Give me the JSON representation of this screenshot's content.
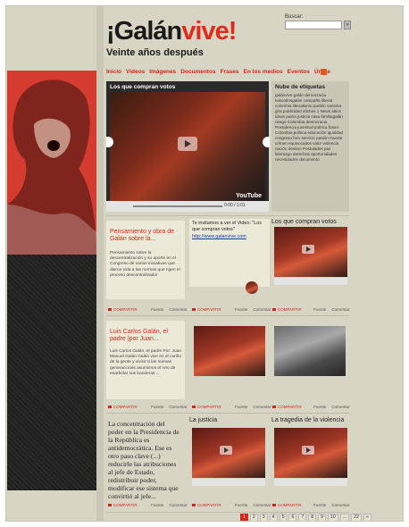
{
  "header": {
    "logo_main": "¡Galán",
    "logo_accent": "vive!",
    "tagline": "Veinte años después"
  },
  "search": {
    "label": "Buscar:",
    "value": "",
    "button": "»"
  },
  "nav": [
    "Inicio",
    "Videos",
    "Imágenes",
    "Documentos",
    "Frases",
    "En los medios",
    "Eventos",
    "Únete"
  ],
  "video": {
    "title": "Los que compran votos",
    "time": "0:00 / 1:01",
    "brand": "YouTube"
  },
  "tags": {
    "title": "Nube de etiquetas",
    "text": "galánvive galán democracia luiscarlosgalán campaña liberal colombia liberalismo pueblo carisma gira publicidad afiches 1 News altice ideas patria justicia casa familiagalán riesgo Colombia democracia Presidencia juventud política futuro Colombia política educación igualdad congreso foro servicio pasión muerte crimen equivocados valor violencia nación destino Postulados paz liderazgo derechos oportunidades necesidades documento"
  },
  "cards": {
    "c1_title": "Pensamiento y obra de Galán sobre la...",
    "c1_body": "Pensamiento sobre la descentralización y su aporte en el Congreso de varias iniciativas que dieron vida a las normas que rigen el proceso descentralizador",
    "c2_title": "Te invitamos a ver el Video: \"Los que compran votos\"",
    "c2_link": "http://www.galanvive.com",
    "c3_title": "Los que compran votos",
    "c4_title": "Luis Carlos Galán, el padre |por Juan...",
    "c4_body": "Luis Carlos Galán, el padre Por: Juan Manuel Galán Galán vive en el cariño de la gente y vivirá si las nuevas generaciones asumimos el reto de enarbolar sus banderas....",
    "c7_quote": "La concentración del poder en la Presidencia de la República es antidemocrática. Ese es otro paso clave (...) reducirle las atribuciones al jefe de Estado, redistribuir poder, modificar ese sistema que convirtió al jefe...",
    "c8_title": "La justicia",
    "c9_title": "La tragedia de la violencia",
    "share": "COMPARTIR",
    "meta_source": "Fuente",
    "meta_comment": "Comentar"
  },
  "pager": [
    "1",
    "2",
    "3",
    "4",
    "5",
    "6",
    "7",
    "8",
    "9",
    "10",
    "...",
    "22",
    "»"
  ],
  "colors": {
    "accent": "#d4261b",
    "background": "#d7d6c5"
  }
}
